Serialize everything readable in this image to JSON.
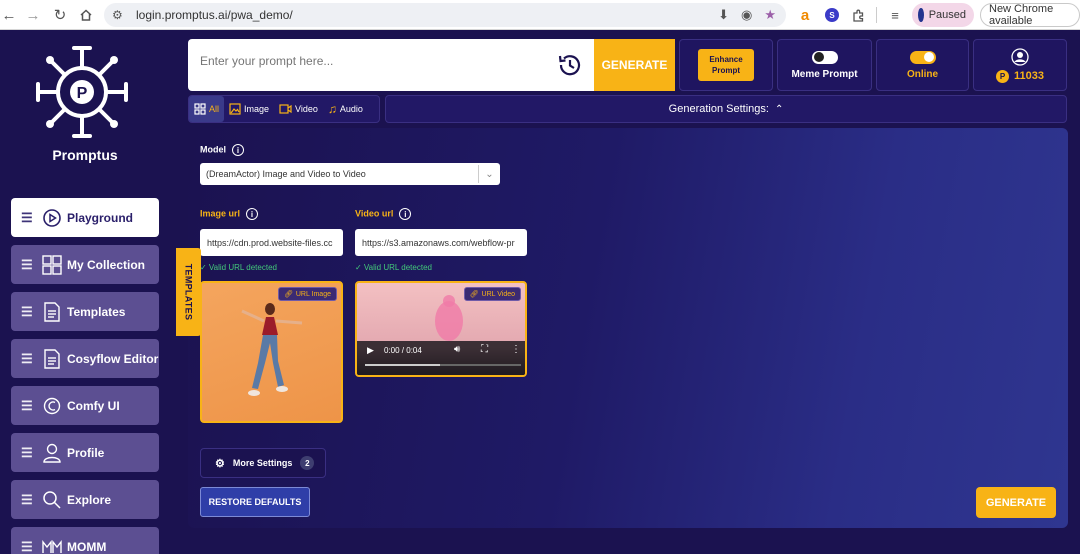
{
  "browser": {
    "url": "login.promptus.ai/pwa_demo/",
    "paused_label": "Paused",
    "update_label": "New Chrome available",
    "ext_s_label": "S"
  },
  "sidebar": {
    "brand": "Promptus",
    "items": [
      {
        "label": "Playground",
        "icon": "play-icon"
      },
      {
        "label": "My Collection",
        "icon": "grid-icon"
      },
      {
        "label": "Templates",
        "icon": "document-icon"
      },
      {
        "label": "Cosyflow Editor",
        "icon": "document-icon"
      },
      {
        "label": "Comfy UI",
        "icon": "comfy-icon"
      },
      {
        "label": "Profile",
        "icon": "user-icon"
      },
      {
        "label": "Explore",
        "icon": "search-icon"
      },
      {
        "label": "MOMM",
        "icon": "momm-icon"
      }
    ],
    "templates_tab": "TEMPLATES"
  },
  "topbar": {
    "prompt_placeholder": "Enter your prompt here...",
    "generate_label": "GENERATE",
    "enhance_label": "Enhance Prompt",
    "meme_label": "Meme Prompt",
    "online_label": "Online",
    "credits": "11033"
  },
  "filters": {
    "tabs": [
      "All",
      "Image",
      "Video",
      "Audio"
    ],
    "generation_settings": "Generation Settings:"
  },
  "form": {
    "model_label": "Model",
    "model_value": "(DreamActor) Image and Video to Video",
    "image_url_label": "Image url",
    "image_url_value": "https://cdn.prod.website-files.cc",
    "video_url_label": "Video url",
    "video_url_value": "https://s3.amazonaws.com/webflow-pr",
    "valid_text": "✓ Valid URL detected",
    "url_image_badge": "URL Image",
    "url_video_badge": "URL Video",
    "video_time": "0:00 / 0:04",
    "more_settings": "More Settings",
    "more_settings_count": "2",
    "restore_defaults": "RESTORE DEFAULTS",
    "generate_label": "GENERATE"
  },
  "colors": {
    "accent": "#f8b316",
    "background": "#1b1250",
    "valid": "#43c97a"
  }
}
